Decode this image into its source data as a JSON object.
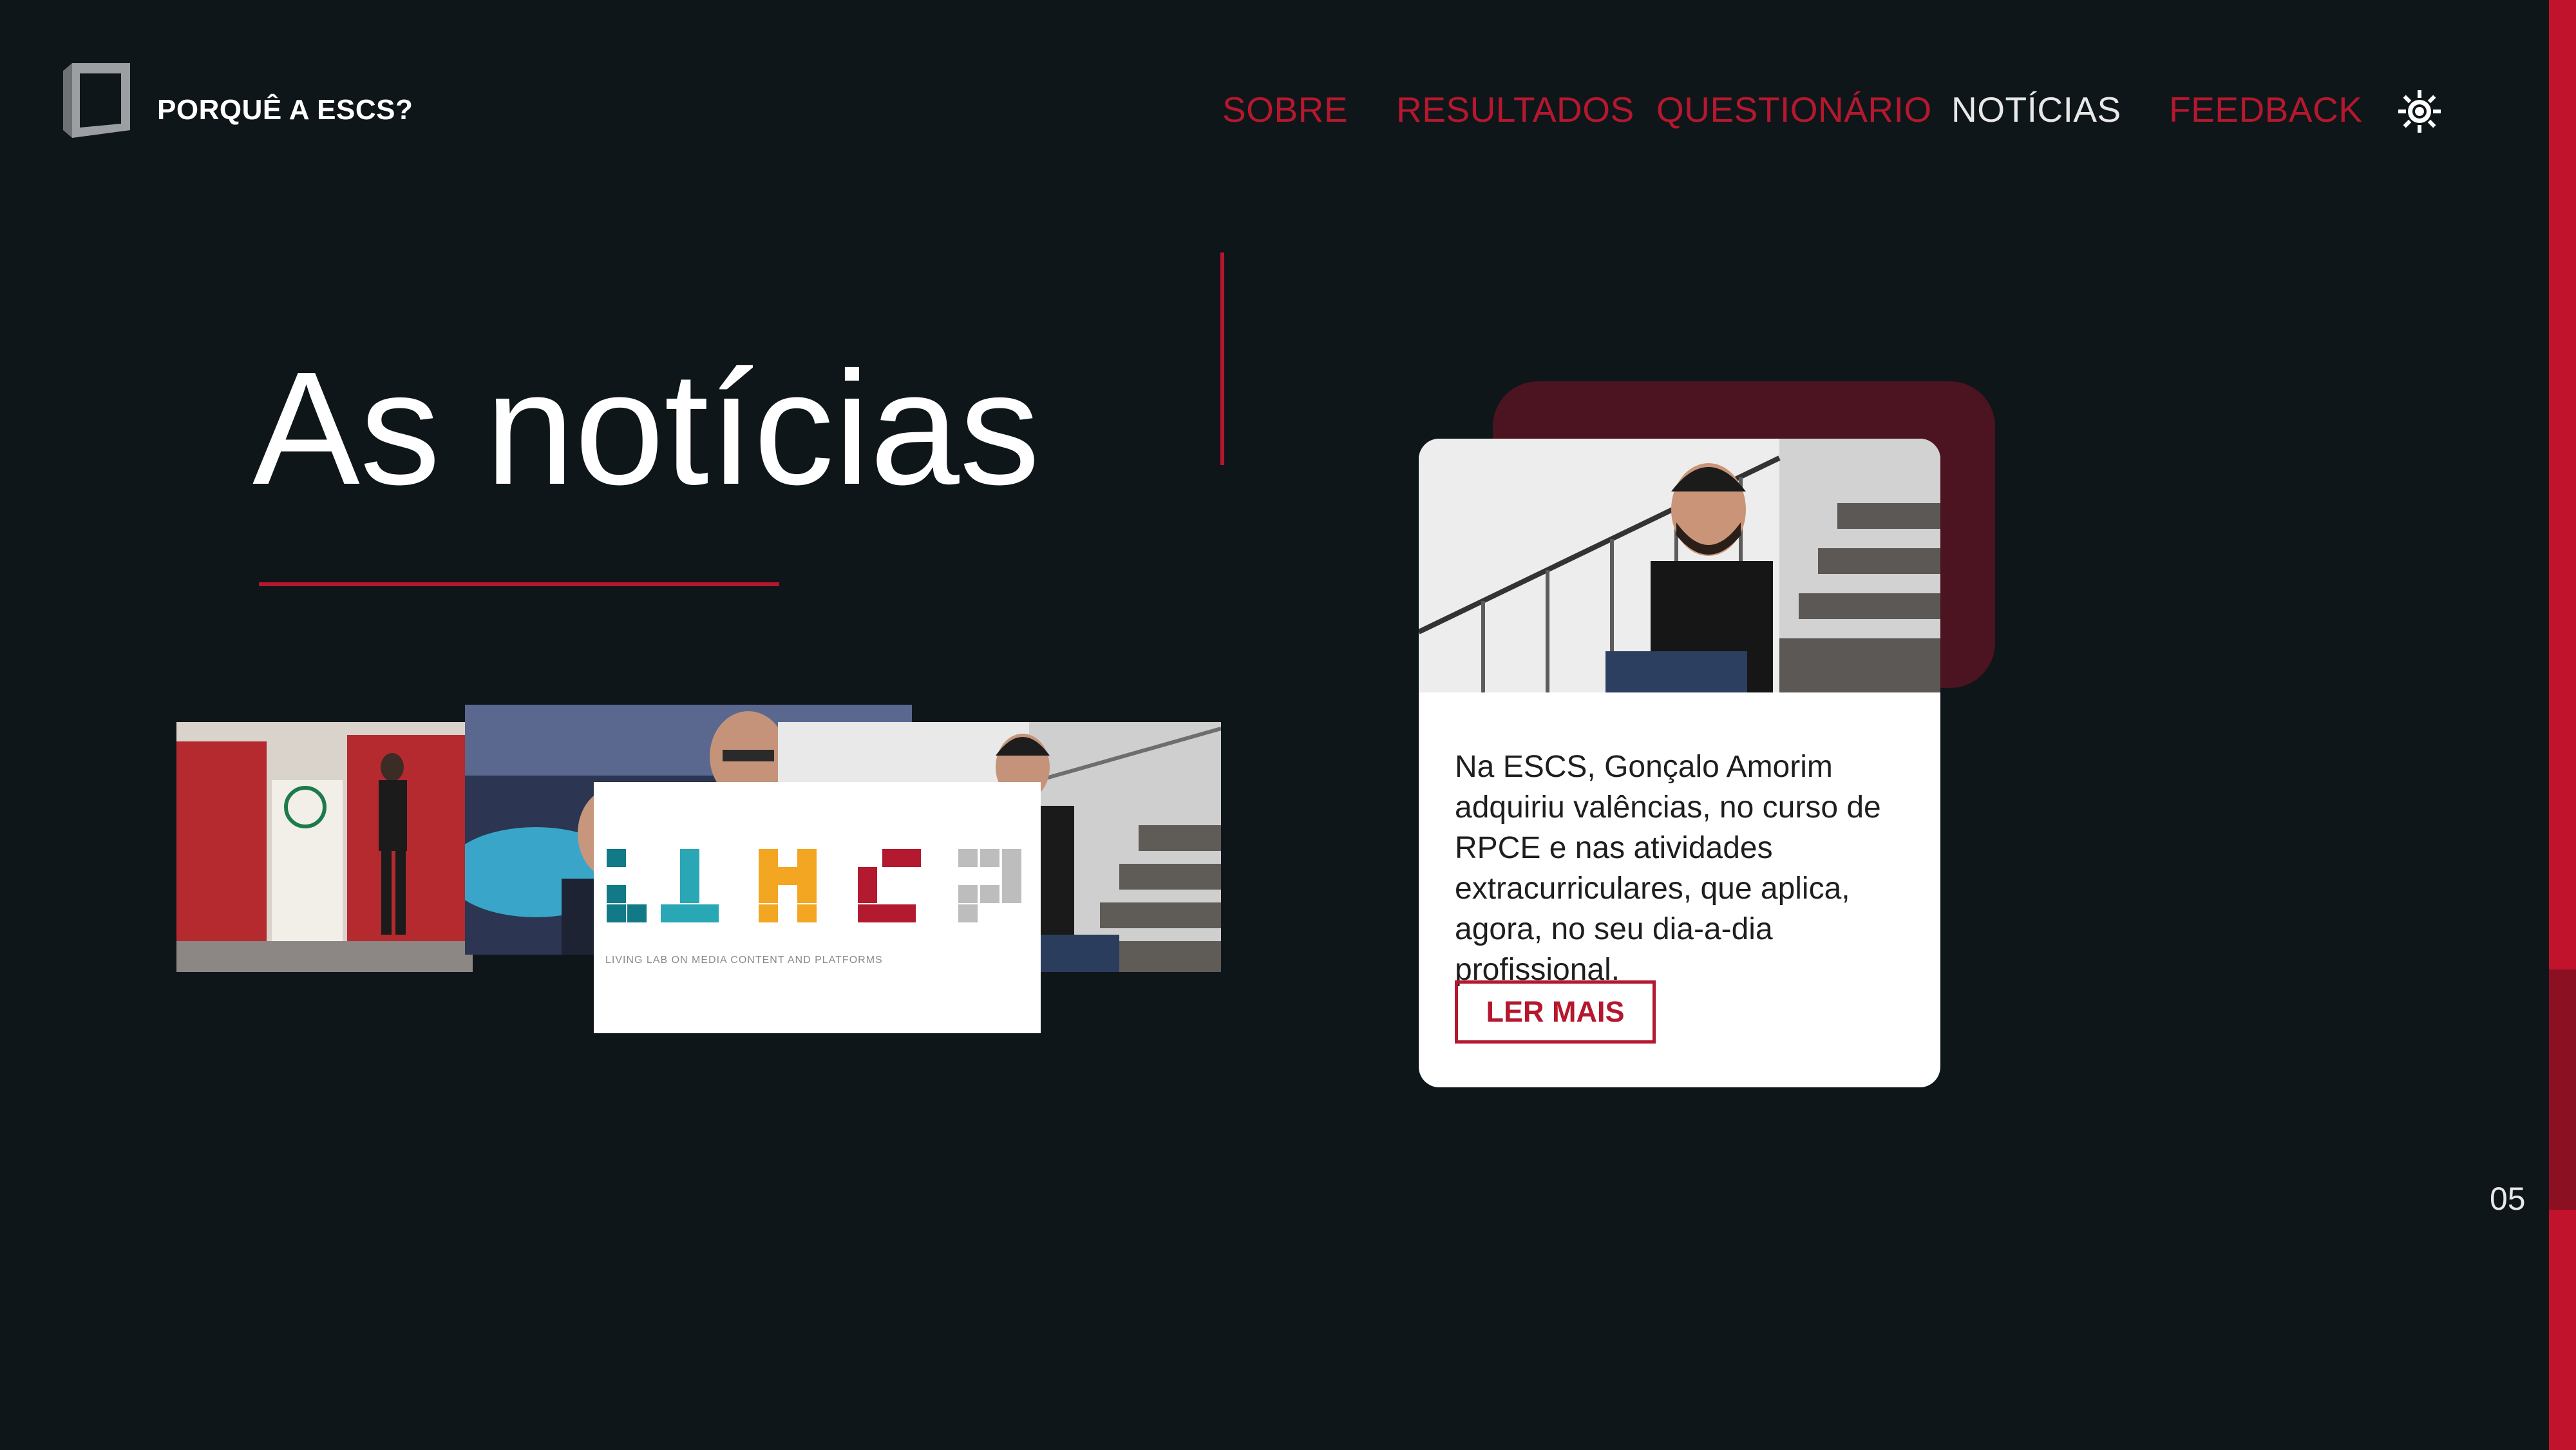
{
  "header": {
    "brand": "PORQUÊ A ESCS?",
    "nav": [
      {
        "label": "SOBRE",
        "active": false
      },
      {
        "label": "RESULTADOS",
        "active": false
      },
      {
        "label": "QUESTIONÁRIO",
        "active": false
      },
      {
        "label": "NOTÍCIAS",
        "active": true
      },
      {
        "label": "FEEDBACK",
        "active": false
      }
    ],
    "theme_icon": "sun-icon"
  },
  "hero": {
    "title": "As notícias"
  },
  "thumbnails": [
    {
      "kind": "photo",
      "subject": "speaker-at-conference"
    },
    {
      "kind": "photo",
      "subject": "selfie-group"
    },
    {
      "kind": "photo",
      "subject": "man-on-stairs"
    },
    {
      "kind": "logo",
      "caption": "LIVING LAB ON MEDIA CONTENT AND PLATFORMS"
    }
  ],
  "card": {
    "text": "Na ESCS, Gonçalo Amorim adquiriu valências, no curso de RPCE e nas atividades extracurriculares, que aplica, agora, no seu dia-a-dia profissional.",
    "button_label": "LER MAIS"
  },
  "page_number": "05",
  "colors": {
    "background": "#0f1619",
    "accent": "#b5182e",
    "card_shadow": "#4b1420"
  }
}
